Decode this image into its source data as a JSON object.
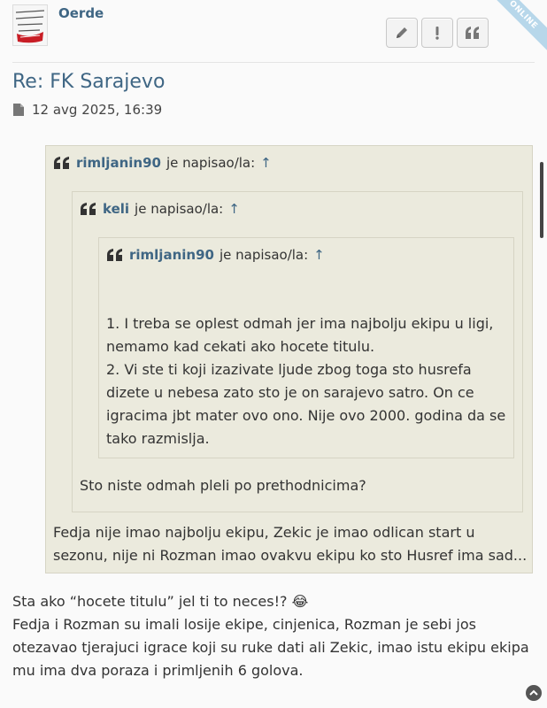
{
  "post": {
    "username": "Oerde",
    "online_label": "ONLINE",
    "title": "Re: FK Sarajevo",
    "date": "12 avg 2025, 16:39"
  },
  "buttons": {
    "edit_icon": "pencil-icon",
    "report_icon": "exclamation-icon",
    "quote_icon": "quote-icon"
  },
  "quotes": {
    "outer": {
      "author": "rimljanin90",
      "wrote": "je napisao/la:",
      "arrow": "↑",
      "text": "Fedja nije imao najbolju ekipu, Zekic je imao odlican start u sezonu, nije ni Rozman imao ovakvu ekipu ko sto Husref ima sad..."
    },
    "middle": {
      "author": "keli",
      "wrote": "je napisao/la:",
      "arrow": "↑",
      "text": "Sto niste odmah pleli po prethodnicima?"
    },
    "inner": {
      "author": "rimljanin90",
      "wrote": "je napisao/la:",
      "arrow": "↑",
      "line1": "1. I treba se oplest odmah jer ima najbolju ekipu u ligi, nemamo kad cekati ako hocete titulu.",
      "line2": "2. Vi ste ti koji izazivate ljude zbog toga sto husrefa dizete u nebesa zato sto je on sarajevo satro. On ce igracima jbt mater ovo ono. Nije ovo 2000. godina da se tako razmislja."
    }
  },
  "reply": {
    "line1": "Sta ako “hocete titulu” jel ti to neces!?",
    "emoji": "😂",
    "line2": "Fedja i Rozman su imali losije ekipe, cinjenica, Rozman je sebi jos otezavao tjerajuci igrace koji su ruke dati ali Zekic, imao istu ekipu ekipa mu ima dva poraza i primljenih 6 golova."
  }
}
